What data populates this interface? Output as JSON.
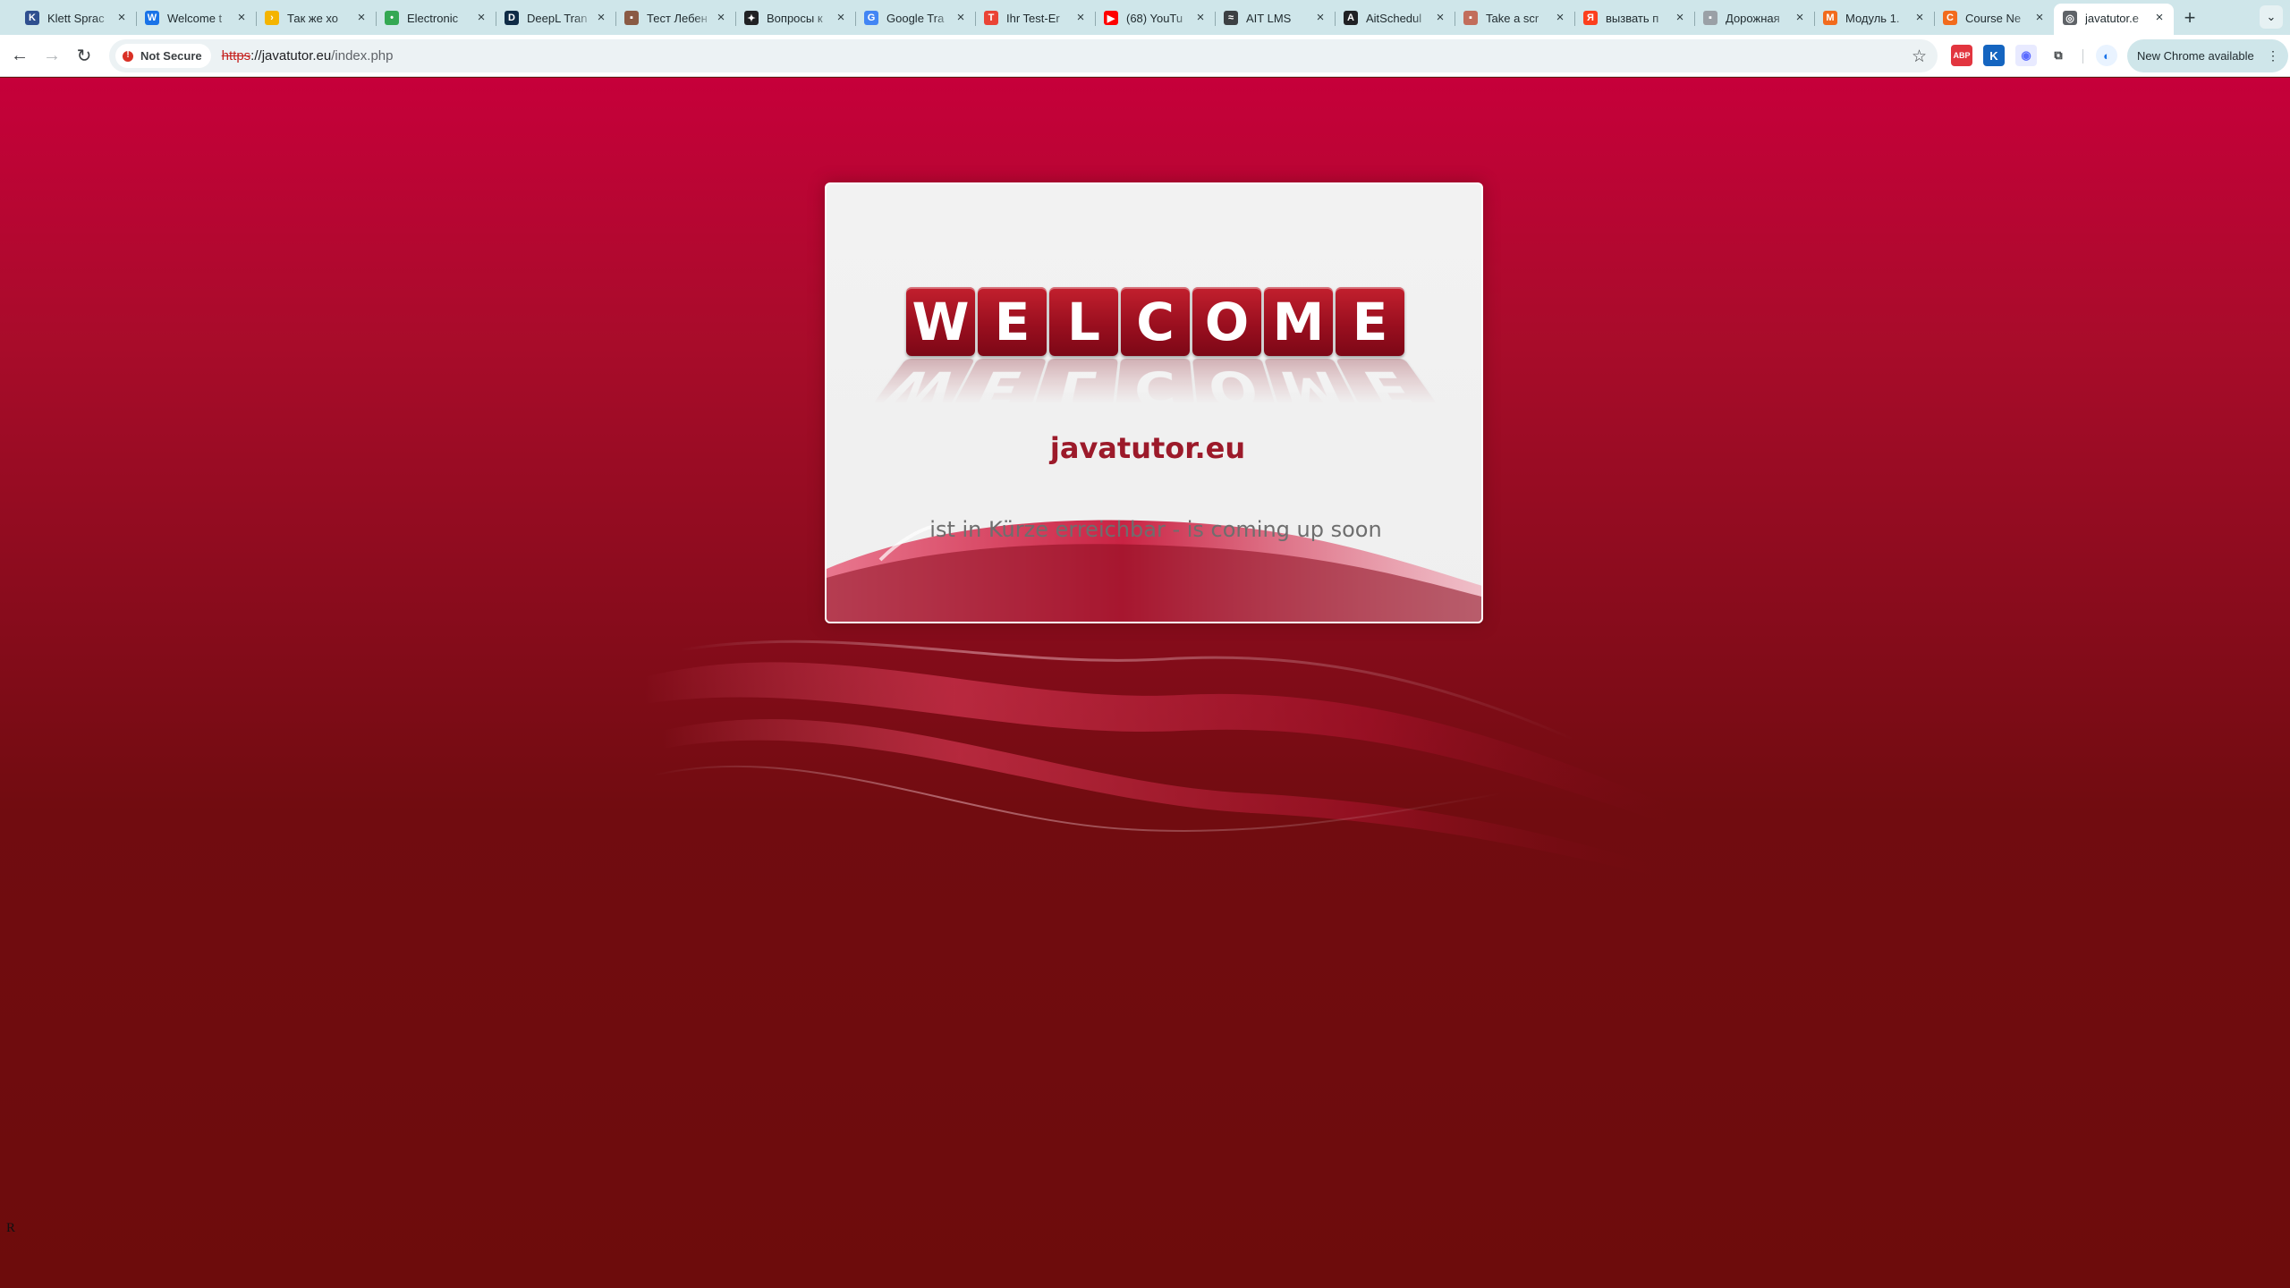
{
  "browser": {
    "tabs": [
      {
        "title": "Klett Sprac",
        "favicon": "klett-icon",
        "color": "#2f4f8f",
        "glyph": "K"
      },
      {
        "title": "Welcome t",
        "favicon": "globe-icon",
        "color": "#1a73e8",
        "glyph": "W"
      },
      {
        "title": "Так же хо",
        "favicon": "arrow-icon",
        "color": "#f4b400",
        "glyph": "›"
      },
      {
        "title": "Electronic",
        "favicon": "green-circle-icon",
        "color": "#34a853",
        "glyph": "•"
      },
      {
        "title": "DeepL Tran",
        "favicon": "deepl-icon",
        "color": "#0f2b46",
        "glyph": "D"
      },
      {
        "title": "Тест Лебен",
        "favicon": "flag-icon",
        "color": "#8a5a44",
        "glyph": "▪"
      },
      {
        "title": "Вопросы к",
        "favicon": "openai-icon",
        "color": "#202124",
        "glyph": "✦"
      },
      {
        "title": "Google Tra",
        "favicon": "google-translate-icon",
        "color": "#4285f4",
        "glyph": "G"
      },
      {
        "title": "Ihr Test-Er",
        "favicon": "test-icon",
        "color": "#ea4335",
        "glyph": "T"
      },
      {
        "title": "(68) YouTu",
        "favicon": "youtube-icon",
        "color": "#ff0000",
        "glyph": "▶"
      },
      {
        "title": "AIT LMS",
        "favicon": "ait-icon",
        "color": "#3c4043",
        "glyph": "≈"
      },
      {
        "title": "AitSchedul",
        "favicon": "a-icon",
        "color": "#202124",
        "glyph": "A"
      },
      {
        "title": "Take a scr",
        "favicon": "screenshot-icon",
        "color": "#c26d5b",
        "glyph": "▪"
      },
      {
        "title": "вызвать п",
        "favicon": "yandex-icon",
        "color": "#fc3f1d",
        "glyph": "Я"
      },
      {
        "title": "Дорожная",
        "favicon": "doc-icon",
        "color": "#9aa0a6",
        "glyph": "▪"
      },
      {
        "title": "Модуль 1.",
        "favicon": "module-icon",
        "color": "#f26b1d",
        "glyph": "M"
      },
      {
        "title": "Course Ne",
        "favicon": "course-icon",
        "color": "#f26b1d",
        "glyph": "C"
      },
      {
        "title": "javatutor.e",
        "favicon": "globe-icon",
        "color": "#5f6368",
        "glyph": "◎",
        "active": true
      }
    ],
    "new_tab": "+",
    "tab_search": "⌄",
    "nav": {
      "back": "←",
      "forward": "→",
      "reload": "↻"
    },
    "security_label": "Not Secure",
    "url": {
      "scheme": "https",
      "sep": "://",
      "host": "javatutor.eu",
      "path": "/index.php"
    },
    "bookmark_icon": "☆",
    "extensions": [
      {
        "name": "adblock-icon",
        "glyph": "ABP",
        "color": "#e2353f",
        "text": "#ffffff"
      },
      {
        "name": "k-extension-icon",
        "glyph": "K",
        "color": "#1565c0",
        "text": "#ffffff"
      },
      {
        "name": "screen-capture-icon",
        "glyph": "◉",
        "color": "#e8eaff",
        "text": "#5b6bff"
      },
      {
        "name": "puzzle-extensions-icon",
        "glyph": "⧉",
        "color": "#ffffff",
        "text": "#3c4043"
      }
    ],
    "profile_glyph": "◐",
    "update_label": "New Chrome available",
    "update_menu": "⋮"
  },
  "page": {
    "welcome_letters": [
      "W",
      "E",
      "L",
      "C",
      "O",
      "M",
      "E"
    ],
    "site_name": "javatutor.eu",
    "tagline": "ist in Kürze erreichbar - is coming up soon",
    "corner_mark": "R",
    "colors": {
      "tile": "#9a0f1f",
      "site_name": "#9c1a2a",
      "background_top": "#c6003a",
      "background_bottom": "#6d0c0c"
    }
  }
}
